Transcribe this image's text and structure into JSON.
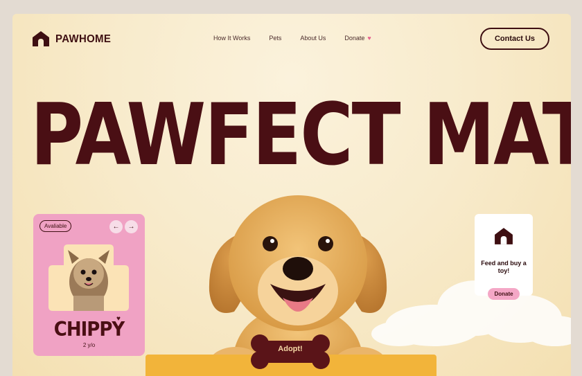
{
  "brand": {
    "name": "PAWHOME",
    "icon": "house-paw-icon"
  },
  "nav": {
    "items": [
      {
        "label": "How It Works"
      },
      {
        "label": "Pets"
      },
      {
        "label": "About Us"
      },
      {
        "label": "Donate",
        "icon": "heart-icon"
      }
    ]
  },
  "header": {
    "contact_label": "Contact Us"
  },
  "hero": {
    "headline": "PAWFECT MATCH"
  },
  "pet_card": {
    "status": "Avaliable",
    "prev_icon": "arrow-left-icon",
    "next_icon": "arrow-right-icon",
    "name": "CHIPPY",
    "age": "2 y/o"
  },
  "donate_card": {
    "icon": "house-paw-icon",
    "text": "Feed and buy a toy!",
    "button_label": "Donate"
  },
  "adopt": {
    "label": "Adopt!"
  },
  "colors": {
    "brand_dark": "#4a0f14",
    "background": "#f8ebcc",
    "pink": "#f0a2c4",
    "accent_yellow": "#f2b43a"
  }
}
